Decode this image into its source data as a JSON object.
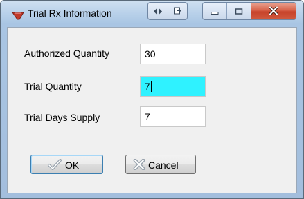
{
  "window": {
    "title": "Trial Rx Information",
    "title_icon": "pill-icon",
    "caption_buttons": [
      "arrows-icon",
      "restore-page-icon",
      "minimize-icon",
      "maximize-icon",
      "close-icon"
    ]
  },
  "form": {
    "authorized_quantity": {
      "label": "Authorized Quantity",
      "value": "30"
    },
    "trial_quantity": {
      "label": "Trial Quantity",
      "value": "7"
    },
    "trial_days_supply": {
      "label": "Trial Days Supply",
      "value": "7"
    }
  },
  "buttons": {
    "ok": {
      "label": "OK",
      "icon": "checkmark-icon"
    },
    "cancel": {
      "label": "Cancel",
      "icon": "x-icon"
    }
  },
  "colors": {
    "active_field": "#2ff2ff",
    "close_button": "#c7432b",
    "title_icon": "#c0392b"
  }
}
